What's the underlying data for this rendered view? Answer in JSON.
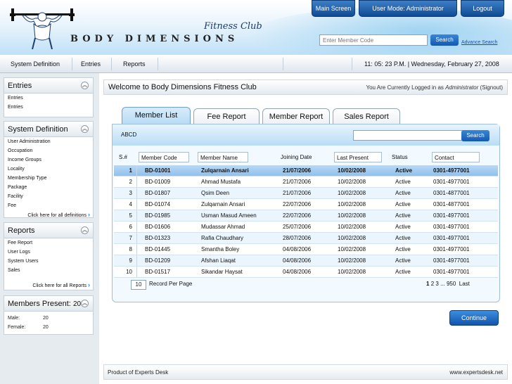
{
  "brand": {
    "name": "BODY DIMENSIONS",
    "tagline": "Fitness Club"
  },
  "top_buttons": {
    "main_screen": "Main Screen",
    "user_mode": "User Mode: Administrator",
    "logout": "Logout"
  },
  "header_search": {
    "placeholder": "Enter Member Code",
    "button": "Search",
    "advanced": "Advance Search"
  },
  "nav": {
    "items": [
      "System Definition",
      "Entries",
      "Reports"
    ],
    "clock": "11: 05: 23 P.M.  |  Wednesday, February 27, 2008"
  },
  "sidebar": {
    "entries": {
      "title": "Entries",
      "items": [
        "Entries",
        "Entries"
      ]
    },
    "system_definition": {
      "title": "System Definition",
      "items": [
        "User Administration",
        "Occupation",
        "Income Groups",
        "Locality",
        "Membership Type",
        "Package",
        "Facility",
        "Fee"
      ],
      "more": "Click here for all definitions"
    },
    "reports": {
      "title": "Reports",
      "items": [
        "Fee Report",
        "User Logs",
        "System Users",
        "Sales"
      ],
      "more": "Click here for all Reports"
    },
    "members_present": {
      "title": "Members Present:",
      "count": "20",
      "rows": [
        {
          "label": "Male:",
          "value": "20"
        },
        {
          "label": "Female:",
          "value": "20"
        }
      ]
    }
  },
  "welcome": {
    "title": "Welcome to Body Dimensions Fitness Club",
    "logged_prefix": "You Are Currently Logged in as",
    "role": "Administrator",
    "signout": "(Signout)"
  },
  "tabs": [
    "Member List",
    "Fee Report",
    "Member Report",
    "Sales Report"
  ],
  "grid": {
    "label": "ABCD",
    "search_button": "Search",
    "columns": [
      "S.#",
      "Member Code",
      "Member Name",
      "Joining Date",
      "Last Present",
      "Status",
      "Contact"
    ],
    "rows": [
      [
        "1",
        "BD-01001",
        "Zulqarnain Ansari",
        "21/07/2006",
        "10/02/2008",
        "Active",
        "0301-4977001"
      ],
      [
        "2",
        "BD-01009",
        "Ahmad Mustafa",
        "21/07/2006",
        "10/02/2008",
        "Active",
        "0301-4977001"
      ],
      [
        "3",
        "BD-01807",
        "Qsim Deen",
        "21/07/2006",
        "10/02/2008",
        "Active",
        "0301-4877001"
      ],
      [
        "4",
        "BD-01074",
        "Zulqarnain Ansari",
        "22/07/2006",
        "10/02/2008",
        "Active",
        "0301-4877001"
      ],
      [
        "5",
        "BD-01985",
        "Usman Masud Ameen",
        "22/07/2006",
        "10/02/2008",
        "Active",
        "0301-4977001"
      ],
      [
        "6",
        "BD-01606",
        "Mudassar Ahmad",
        "25/07/2006",
        "10/02/2008",
        "Active",
        "0301-4977001"
      ],
      [
        "7",
        "BD-01323",
        "Rafia Chaudhary",
        "28/07/2006",
        "10/02/2008",
        "Active",
        "0301-4977001"
      ],
      [
        "8",
        "BD-01445",
        "Smantha Boley",
        "04/08/2006",
        "10/02/2008",
        "Active",
        "0301-4977001"
      ],
      [
        "9",
        "BD-01209",
        "Afshan Liaqat",
        "04/08/2006",
        "10/02/2008",
        "Active",
        "0301-4977001"
      ],
      [
        "10",
        "BD-01517",
        "Sikandar Haysat",
        "04/08/2006",
        "10/02/2008",
        "Active",
        "0301-4977001"
      ]
    ],
    "records_per_page": "10",
    "records_label": "Record Per Page",
    "pager": {
      "pages": [
        "1",
        "2",
        "3",
        "...",
        "950"
      ],
      "last": "Last"
    }
  },
  "continue_button": "Continue",
  "footer": {
    "left": "Product of Experts Desk",
    "right": "www.expertsdesk.net"
  },
  "colors": {
    "accent": "#135ab0",
    "header_light": "#bfe1f7",
    "selected_row": "#8fc0ed"
  }
}
